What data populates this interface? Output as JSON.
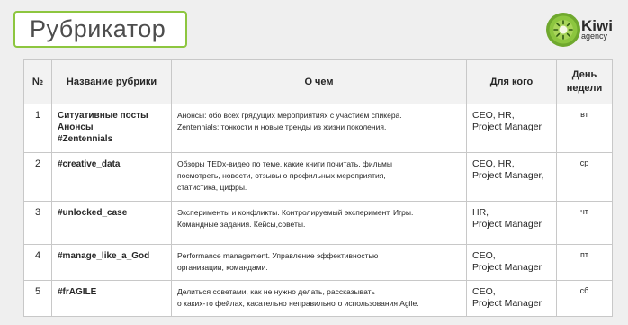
{
  "title": "Рубрикатор",
  "logo": {
    "main": "Kiwi",
    "sub": "agency"
  },
  "table": {
    "headers": [
      "№",
      "Название рубрики",
      "О чем",
      "Для кого",
      "День недели"
    ],
    "rows": [
      {
        "num": "1",
        "name": [
          "Ситуативные посты",
          "Анонсы",
          "#Zentennials"
        ],
        "about": [
          "Анонсы: обо всех грядущих мероприятиях с участием спикера.",
          "Zentennials: тонкости и новые тренды из жизни поколения."
        ],
        "who": [
          "CEO, HR,",
          "Project Manager"
        ],
        "day": "вт"
      },
      {
        "num": "2",
        "name": [
          "#creative_data"
        ],
        "about": [
          "Обзоры TEDx-видео по теме, какие книги почитать, фильмы",
          "посмотреть, новости, отзывы о профильных мероприятия,",
          "статистика, цифры."
        ],
        "who": [
          "CEO, HR,",
          "Project Manager,"
        ],
        "day": "ср"
      },
      {
        "num": "3",
        "name": [
          "#unlocked_case"
        ],
        "about": [
          "Эксперименты и конфликты. Контролируемый эксперимент. Игры.",
          "Командные задания. Кейсы,советы."
        ],
        "who": [
          "HR,",
          "Project Manager"
        ],
        "day": "чт"
      },
      {
        "num": "4",
        "name": [
          "#manage_like_a_God"
        ],
        "about": [
          "Performance management. Управление эффективностью",
          "организации, командами."
        ],
        "who": [
          "CEO,",
          "Project Manager"
        ],
        "day": "пт"
      },
      {
        "num": "5",
        "name": [
          "#frAGILE"
        ],
        "about": [
          "Делиться советами, как не нужно делать, рассказывать",
          "о каких-то фейлах, касательно неправильного использования Agile."
        ],
        "who": [
          "CEO,",
          "Project Manager"
        ],
        "day": "сб"
      }
    ]
  }
}
